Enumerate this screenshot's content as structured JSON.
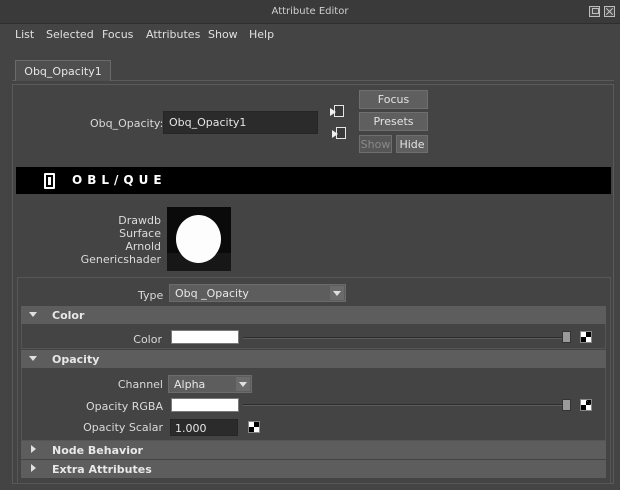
{
  "window": {
    "title": "Attribute Editor"
  },
  "menu": [
    "List",
    "Selected",
    "Focus",
    "Attributes",
    "Show",
    "Help"
  ],
  "tab": {
    "label": "Obq_Opacity1"
  },
  "node": {
    "label": "Obq_Opacity:",
    "value": "Obq_Opacity1"
  },
  "buttons": {
    "focus": "Focus",
    "presets": "Presets",
    "show": "Show",
    "hide": "Hide"
  },
  "banner": {
    "text": "OBL/QUE"
  },
  "shader_names": [
    "Drawdb",
    "Surface",
    "Arnold",
    "Genericshader"
  ],
  "type": {
    "label": "Type",
    "value": "Obq _Opacity"
  },
  "sections": {
    "color": {
      "title": "Color",
      "expanded": true,
      "color_label": "Color",
      "color_value": "#ffffff"
    },
    "opacity": {
      "title": "Opacity",
      "expanded": true,
      "channel_label": "Channel",
      "channel_value": "Alpha",
      "rgba_label": "Opacity RGBA",
      "rgba_value": "#ffffff",
      "scalar_label": "Opacity Scalar",
      "scalar_value": "1.000"
    },
    "node_behavior": {
      "title": "Node Behavior",
      "expanded": false
    },
    "extra_attributes": {
      "title": "Extra Attributes",
      "expanded": false
    }
  }
}
